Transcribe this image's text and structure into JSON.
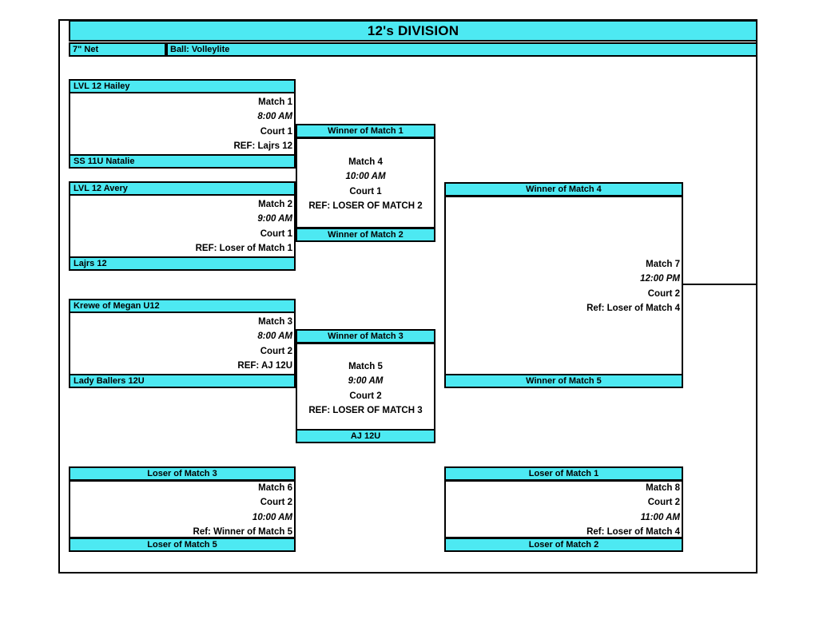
{
  "header": {
    "title": "12's DIVISION",
    "net": "7\" Net",
    "ball": "Ball:  Volleylite"
  },
  "bracket": {
    "match1": {
      "top_team": "LVL 12 Hailey",
      "bottom_team": "SS 11U Natalie",
      "line1": "Match 1",
      "line2": "8:00 AM",
      "line3": "Court 1",
      "line4": "REF:  Lajrs 12"
    },
    "match2": {
      "top_team": "LVL 12 Avery",
      "bottom_team": "Lajrs 12",
      "line1": "Match 2",
      "line2": "9:00 AM",
      "line3": "Court 1",
      "line4": "REF:  Loser of Match 1"
    },
    "match3": {
      "top_team": "Krewe of Megan U12",
      "bottom_team": "Lady Ballers 12U",
      "line1": "Match 3",
      "line2": "8:00 AM",
      "line3": "Court 2",
      "line4": "REF: AJ 12U"
    },
    "match4": {
      "top_team": "Winner of Match 1",
      "bottom_team": "Winner of Match 2",
      "line1": "Match 4",
      "line2": "10:00 AM",
      "line3": "Court 1",
      "line4": "REF:  LOSER OF MATCH 2"
    },
    "match5": {
      "top_team": "Winner of Match 3",
      "bottom_team": "AJ 12U",
      "line1": "Match 5",
      "line2": "9:00 AM",
      "line3": "Court 2",
      "line4": "REF:  LOSER OF MATCH 3"
    },
    "match7": {
      "top_team": "Winner of Match 4",
      "bottom_team": "Winner of Match 5",
      "line1": "Match 7",
      "line2": "12:00 PM",
      "line3": "Court 2",
      "line4": "Ref:  Loser of Match 4"
    },
    "match6": {
      "top_team": "Loser of Match 3",
      "bottom_team": "Loser of Match 5",
      "line1": "Match 6",
      "line2": "Court 2",
      "line3": "10:00 AM",
      "line4": "Ref:  Winner of Match 5"
    },
    "match8": {
      "top_team": "Loser of Match 1",
      "bottom_team": "Loser of Match 2",
      "line1": "Match 8",
      "line2": "Court 2",
      "line3": "11:00 AM",
      "line4": "Ref:  Loser of Match 4"
    }
  },
  "colors": {
    "slot_fill": "#4DE9F2",
    "line": "#000000",
    "page_bg": "#FFFFFF"
  }
}
